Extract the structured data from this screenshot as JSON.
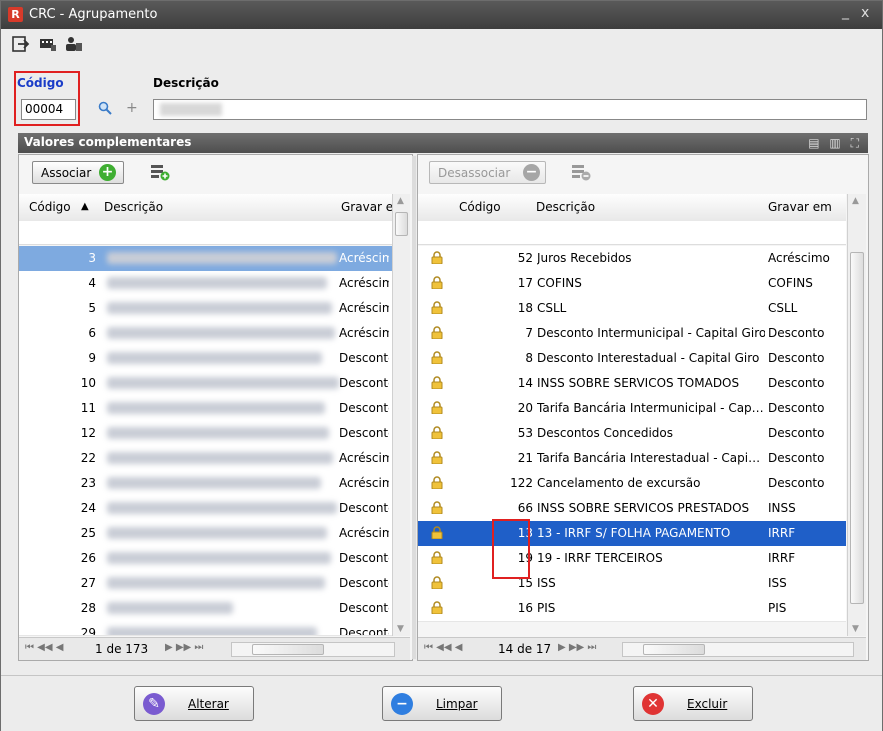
{
  "window": {
    "title": "CRC - Agrupamento",
    "minimize": "_",
    "close": "x",
    "app_icon": "R"
  },
  "toolbar": {
    "icons": [
      "exit-icon",
      "keyboard-icon",
      "users-icon"
    ]
  },
  "form": {
    "code_label": "Código",
    "code_value": "00004",
    "description_label": "Descrição"
  },
  "group": {
    "title": "Valores complementares"
  },
  "left": {
    "assoc_label": "Associar",
    "columns": {
      "code": "Código",
      "sort": "▲",
      "desc": "Descrição",
      "save": "Gravar e"
    },
    "rows": [
      {
        "code": "3",
        "save": "Acréscim"
      },
      {
        "code": "4",
        "save": "Acréscim"
      },
      {
        "code": "5",
        "save": "Acréscim"
      },
      {
        "code": "6",
        "save": "Acréscim"
      },
      {
        "code": "9",
        "save": "Descontc"
      },
      {
        "code": "10",
        "save": "Descontc"
      },
      {
        "code": "11",
        "save": "Descontc"
      },
      {
        "code": "12",
        "save": "Descontc"
      },
      {
        "code": "22",
        "save": "Acréscim"
      },
      {
        "code": "23",
        "save": "Acréscim"
      },
      {
        "code": "24",
        "save": "Descontc"
      },
      {
        "code": "25",
        "save": "Acréscim"
      },
      {
        "code": "26",
        "save": "Descontc"
      },
      {
        "code": "27",
        "save": "Descontc"
      },
      {
        "code": "28",
        "save": "Descontc"
      },
      {
        "code": "29",
        "save": "Descontc"
      }
    ],
    "pager": "1 de 173"
  },
  "right": {
    "disassoc_label": "Desassociar",
    "columns": {
      "code": "Código",
      "desc": "Descrição",
      "save": "Gravar em"
    },
    "rows": [
      {
        "code": "52",
        "desc": "Juros Recebidos",
        "save": "Acréscimo"
      },
      {
        "code": "17",
        "desc": "COFINS",
        "save": "COFINS"
      },
      {
        "code": "18",
        "desc": "CSLL",
        "save": "CSLL"
      },
      {
        "code": "7",
        "desc": "Desconto Intermunicipal - Capital Giro",
        "save": "Desconto"
      },
      {
        "code": "8",
        "desc": "Desconto Interestadual - Capital Giro",
        "save": "Desconto"
      },
      {
        "code": "14",
        "desc": "INSS SOBRE SERVICOS TOMADOS",
        "save": "Desconto"
      },
      {
        "code": "20",
        "desc": "Tarifa Bancária Intermunicipal - Cap…",
        "save": "Desconto"
      },
      {
        "code": "53",
        "desc": "Descontos Concedidos",
        "save": "Desconto"
      },
      {
        "code": "21",
        "desc": "Tarifa Bancária Interestadual - Capi…",
        "save": "Desconto"
      },
      {
        "code": "122",
        "desc": "Cancelamento de excursão",
        "save": "Desconto"
      },
      {
        "code": "66",
        "desc": "INSS SOBRE SERVICOS PRESTADOS",
        "save": "INSS"
      },
      {
        "code": "13",
        "desc": "13 - IRRF S/ FOLHA PAGAMENTO",
        "save": "IRRF"
      },
      {
        "code": "19",
        "desc": "19 - IRRF TERCEIROS",
        "save": "IRRF"
      },
      {
        "code": "15",
        "desc": "ISS",
        "save": "ISS"
      },
      {
        "code": "16",
        "desc": "PIS",
        "save": "PIS"
      }
    ],
    "pager": "14 de 17"
  },
  "buttons": {
    "alterar": "Alterar",
    "limpar": "Limpar",
    "excluir": "Excluir"
  },
  "colors": {
    "accent": "#1f5fc8",
    "highlight": "#e02020",
    "code_label": "#1a3cc8"
  }
}
